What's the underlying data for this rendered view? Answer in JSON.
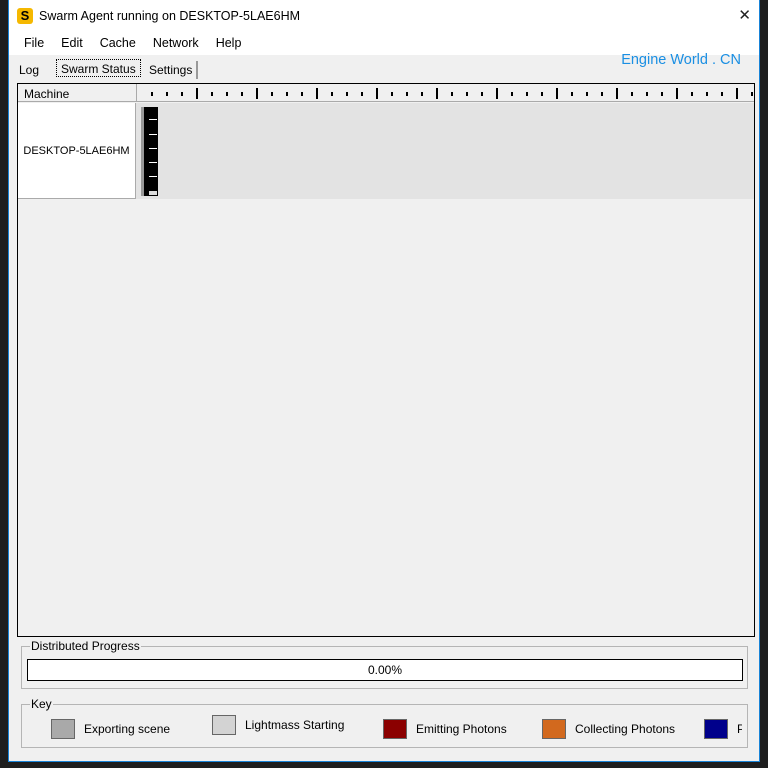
{
  "window": {
    "title": "Swarm Agent running on DESKTOP-5LAE6HM",
    "app_icon": "swarm-s-icon",
    "close_icon": "close-icon"
  },
  "menu": [
    "File",
    "Edit",
    "Cache",
    "Network",
    "Help"
  ],
  "watermark": "Engine World . CN",
  "tabs": [
    {
      "label": "Log"
    },
    {
      "label": "Swarm Status",
      "selected": true
    },
    {
      "label": "Settings"
    }
  ],
  "status": {
    "column_header": "Machine",
    "machines": [
      {
        "name": "DESKTOP-5LAE6HM"
      }
    ]
  },
  "progress": {
    "label": "Distributed Progress",
    "value_text": "0.00%",
    "value": 0
  },
  "key": {
    "label": "Key",
    "items": [
      {
        "label": "Exporting scene",
        "color": "#a9a9a9"
      },
      {
        "label": "Lightmass Starting",
        "color": "#d3d3d3"
      },
      {
        "label": "Emitting Photons",
        "color": "#8b0000"
      },
      {
        "label": "Collecting Photons",
        "color": "#d2691e"
      },
      {
        "label": "Pr",
        "color": "#00008b"
      }
    ]
  }
}
